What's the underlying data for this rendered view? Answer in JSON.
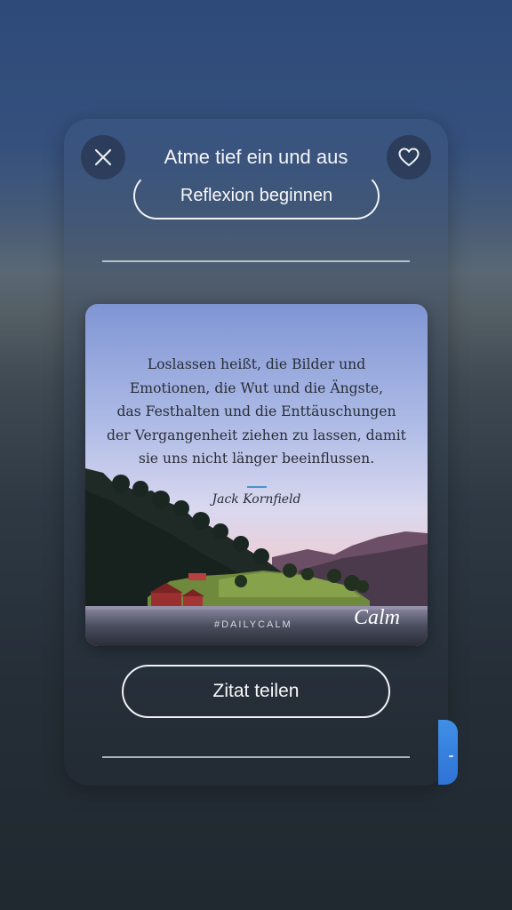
{
  "header": {
    "title": "Atme tief ein und aus",
    "close_icon": "close-icon",
    "favorite_icon": "heart-icon"
  },
  "actions": {
    "reflect_label": "Reflexion beginnen",
    "share_label": "Zitat teilen"
  },
  "quote_card": {
    "quote_lines": [
      "Loslassen heißt, die Bilder und",
      "Emotionen, die Wut und die Ängste,",
      "das Festhalten und die Enttäuschungen",
      "der Vergangenheit ziehen zu lassen, damit",
      "sie uns nicht länger beeinflussen."
    ],
    "author": "Jack Kornfield",
    "hashtag": "#DAILYCALM",
    "brand": "Calm"
  },
  "colors": {
    "accent_line": "#4d93c9",
    "side_tab": "#3f8fe6"
  }
}
